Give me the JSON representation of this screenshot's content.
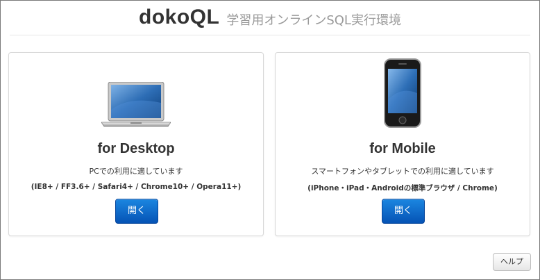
{
  "header": {
    "brand": "dokoQL",
    "tagline": "学習用オンラインSQL実行環境"
  },
  "desktop": {
    "title": "for Desktop",
    "description": "PCでの利用に適しています",
    "requirements": "(IE8+ / FF3.6+ / Safari4+ / Chrome10+ / Opera11+)",
    "button_label": "開く",
    "image_icon": "laptop-icon"
  },
  "mobile": {
    "title": "for Mobile",
    "description": "スマートフォンやタブレットでの利用に適しています",
    "requirements": "(iPhone・iPad・Androidの標準ブラウザ / Chrome)",
    "button_label": "開く",
    "image_icon": "smartphone-icon"
  },
  "footer": {
    "help_label": "ヘルプ"
  },
  "colors": {
    "primary_button": "#0a66c8",
    "brand_text": "#333333",
    "tagline_text": "#999999"
  }
}
